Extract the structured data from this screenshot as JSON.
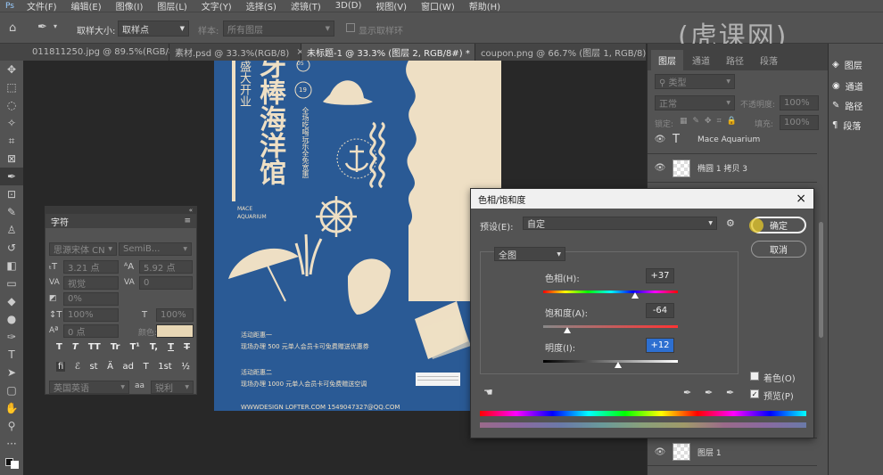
{
  "menu": [
    "文件(F)",
    "编辑(E)",
    "图像(I)",
    "图层(L)",
    "文字(Y)",
    "选择(S)",
    "滤镜(T)",
    "3D(D)",
    "视图(V)",
    "窗口(W)",
    "帮助(H)"
  ],
  "options": {
    "sample_size_label": "取样大小:",
    "sample_size_value": "取样点",
    "sample_label": "样本:",
    "sample_value": "所有图层",
    "show_ring": "显示取样环"
  },
  "tabs": [
    "011811250.jpg @ 89.5%(RGB/8*)",
    "素材.psd @ 33.3%(RGB/8)",
    "未标题-1 @ 33.3% (图层 2, RGB/8#) *",
    "coupon.png @ 66.7% (图层 1, RGB/8)"
  ],
  "poster": {
    "title_small1": "盛大开业",
    "title_big": "牙棒海洋馆",
    "title_prefix": "牙",
    "sub_en1": "MACE",
    "sub_en2": "AQUARIUM",
    "vertical": "全场吃喝玩乐全免宽惠",
    "n1": "05",
    "n2": "19",
    "act1_title": "活动距惠一",
    "act1_text": "现场办理 500 元单人会员卡可免费赠送优惠券",
    "act2_title": "活动距惠二",
    "act2_text": "现场办理 1000 元单人会员卡可免费赠送空调",
    "footer": "WWWDESIGN LOFTER.COM   1549047327@QQ.COM"
  },
  "char_panel": {
    "title": "字符",
    "font": "思源宋体 CN",
    "style": "SemiB...",
    "size": "3.21 点",
    "leading": "5.92 点",
    "kerning": "视觉",
    "tracking": "0",
    "scale_pct": "0%",
    "vscale": "100%",
    "hscale": "100%",
    "baseline": "0 点",
    "color_label": "颜色:",
    "lang": "英国英语",
    "aa_label": "aa",
    "aa": "锐利",
    "type_btns": [
      "T",
      "T",
      "TT",
      "Tr",
      "T¹",
      "T,",
      "T",
      "T"
    ],
    "ot_btns": [
      "fi",
      "ℰ",
      "st",
      "Ä",
      "ad",
      "T",
      "1st",
      "½"
    ],
    "color": "#e8d7b5"
  },
  "dialog": {
    "title": "色相/饱和度",
    "preset_label": "预设(E):",
    "preset_value": "自定",
    "ok": "确定",
    "cancel": "取消",
    "channel": "全图",
    "hue_label": "色相(H):",
    "hue_value": "+37",
    "sat_label": "饱和度(A):",
    "sat_value": "-64",
    "light_label": "明度(I):",
    "light_value": "+12",
    "colorize": "着色(O)",
    "preview": "预览(P)",
    "hue": 37,
    "sat": -64,
    "light": 12
  },
  "layers": {
    "tabs": [
      "图层",
      "通道",
      "路径",
      "段落"
    ],
    "filter": "类型",
    "blend": "正常",
    "opacity_label": "不透明度:",
    "opacity": "100%",
    "lock_label": "锁定:",
    "fill_label": "填充:",
    "fill": "100%",
    "items": [
      "Mace Aquarium",
      "椭圆 1 拷贝 3"
    ],
    "bottom_item": "图层 1"
  },
  "right_panel": [
    "图层",
    "通道",
    "路径",
    "段落"
  ]
}
